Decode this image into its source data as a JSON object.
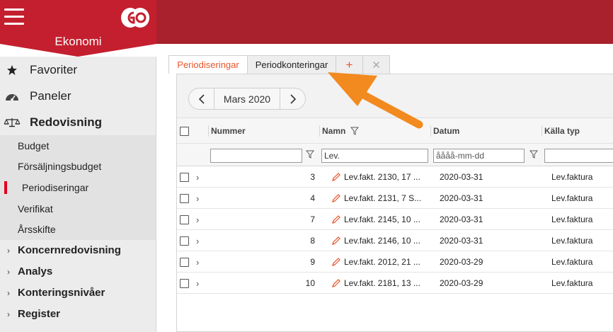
{
  "app": {
    "title": "Ekonomi"
  },
  "sidebar": {
    "top_items": [
      {
        "label": "Favoriter",
        "icon": "star-icon"
      },
      {
        "label": "Paneler",
        "icon": "dashboard-icon"
      },
      {
        "label": "Redovisning",
        "icon": "scales-icon"
      }
    ],
    "sub_items": [
      {
        "label": "Budget"
      },
      {
        "label": "Försäljningsbudget"
      },
      {
        "label": "Periodiseringar",
        "active": true
      },
      {
        "label": "Verifikat"
      },
      {
        "label": "Årsskifte"
      }
    ],
    "groups": [
      {
        "label": "Koncernredovisning"
      },
      {
        "label": "Analys"
      },
      {
        "label": "Konteringsnivåer"
      },
      {
        "label": "Register"
      }
    ]
  },
  "tabs": [
    {
      "label": "Periodiseringar",
      "active": true
    },
    {
      "label": "Periodkonteringar",
      "active": false
    },
    {
      "label": "+"
    },
    {
      "label": "✕"
    }
  ],
  "period": {
    "label": "Mars 2020"
  },
  "table": {
    "columns": [
      "Nummer",
      "Namn",
      "Datum",
      "Källa typ"
    ],
    "filters": {
      "namn_value": "Lev.",
      "datum_placeholder": "åååå-mm-dd"
    },
    "rows": [
      {
        "number": "3",
        "name": "Lev.fakt. 2130, 17 ...",
        "date": "2020-03-31",
        "source": "Lev.faktura"
      },
      {
        "number": "4",
        "name": "Lev.fakt. 2131, 7 S...",
        "date": "2020-03-31",
        "source": "Lev.faktura"
      },
      {
        "number": "7",
        "name": "Lev.fakt. 2145, 10 ...",
        "date": "2020-03-31",
        "source": "Lev.faktura"
      },
      {
        "number": "8",
        "name": "Lev.fakt. 2146, 10 ...",
        "date": "2020-03-31",
        "source": "Lev.faktura"
      },
      {
        "number": "9",
        "name": "Lev.fakt. 2012, 21 ...",
        "date": "2020-03-29",
        "source": "Lev.faktura"
      },
      {
        "number": "10",
        "name": "Lev.fakt. 2181, 13 ...",
        "date": "2020-03-29",
        "source": "Lev.faktura"
      }
    ]
  },
  "colors": {
    "brand": "#a8212c",
    "accent": "#e8562a",
    "arrow": "#f28a1f",
    "active_marker": "#e3001b"
  }
}
